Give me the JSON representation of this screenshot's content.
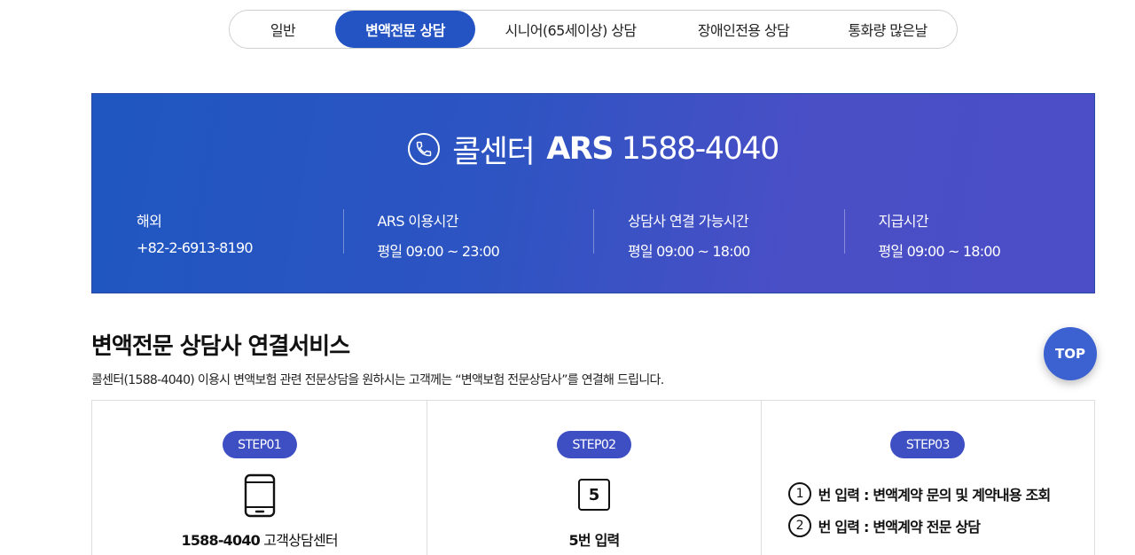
{
  "tabs": [
    {
      "label": "일반"
    },
    {
      "label": "변액전문 상담"
    },
    {
      "label": "시니어(65세이상) 상담"
    },
    {
      "label": "장애인전용 상담"
    },
    {
      "label": "통화량 많은날"
    }
  ],
  "banner": {
    "title_prefix": "콜센터",
    "title_ars": "ARS",
    "title_number": "1588-4040",
    "columns": [
      {
        "label": "해외",
        "value": "+82-2-6913-8190"
      },
      {
        "label": "ARS 이용시간",
        "value": "평일 09:00 ~ 23:00"
      },
      {
        "label": "상담사 연결 가능시간",
        "value": "평일 09:00 ~ 18:00"
      },
      {
        "label": "지급시간",
        "value": "평일 09:00 ~ 18:00"
      }
    ]
  },
  "section": {
    "title": "변액전문 상담사 연결서비스",
    "desc": "콜센터(1588-4040) 이용시 변액보험 관련 전문상담을 원하시는 고객께는 “변액보험 전문상담사”를 연결해 드립니다."
  },
  "steps": [
    {
      "badge": "STEP01",
      "caption_bold": "1588-4040",
      "caption_rest": " 고객상담센터"
    },
    {
      "badge": "STEP02",
      "number": "5",
      "caption": "5번 입력"
    },
    {
      "badge": "STEP03",
      "options": [
        {
          "num": "1",
          "text": "번 입력 : 변액계약 문의 및 계약내용 조회"
        },
        {
          "num": "2",
          "text": "번 입력 : 변액계약 전문 상담"
        }
      ]
    }
  ],
  "top_button": "TOP",
  "colors": {
    "accent": "#2453c4",
    "badge": "#3e4fc4"
  }
}
